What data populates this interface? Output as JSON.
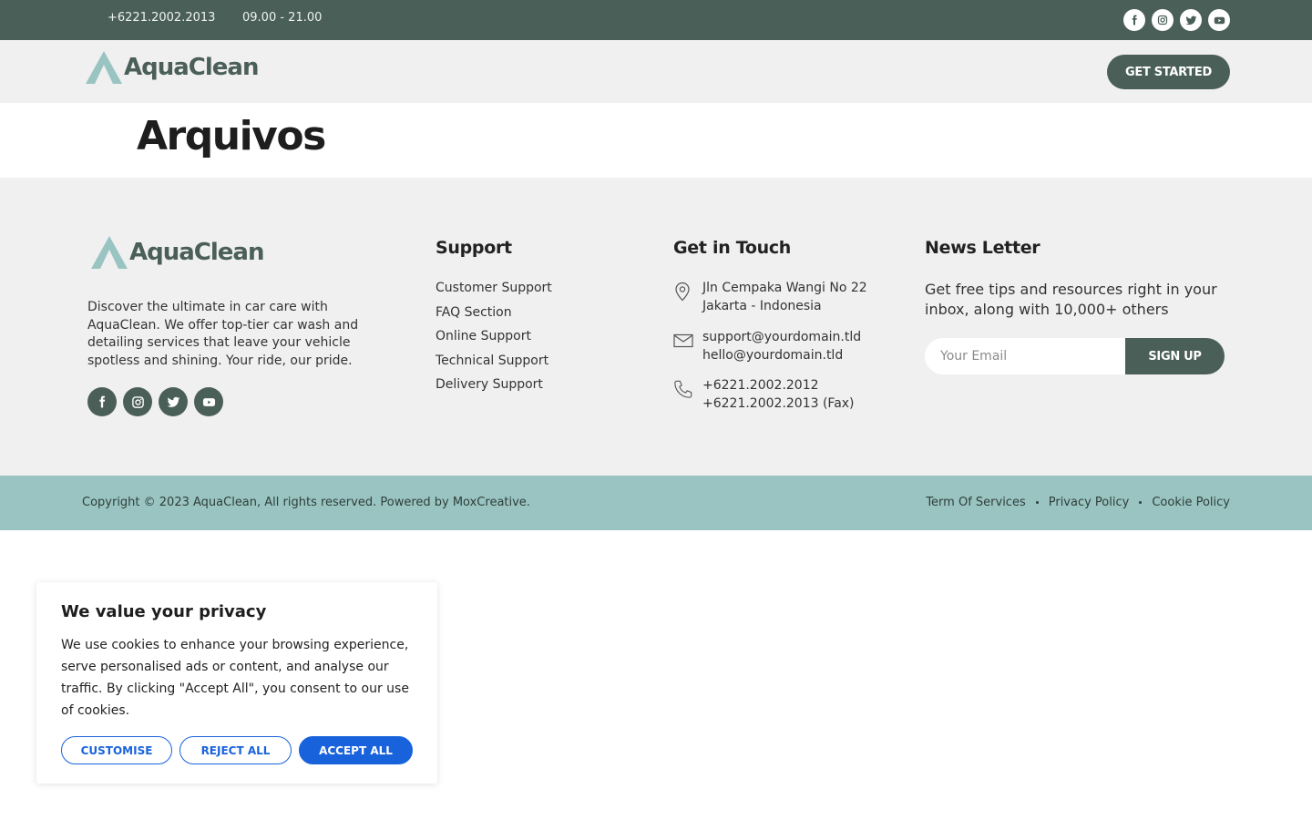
{
  "topbar": {
    "phone": "+6221.2002.2013",
    "hours": "09.00 - 21.00",
    "socials": [
      "facebook-icon",
      "instagram-icon",
      "twitter-icon",
      "youtube-icon"
    ]
  },
  "header": {
    "logo_text": "AquaClean",
    "cta_label": "GET STARTED"
  },
  "page": {
    "title": "Arquivos"
  },
  "footer": {
    "logo_text": "AquaClean",
    "about": "Discover the ultimate in car care with AquaClean. We offer top-tier car wash and detailing services that leave your vehicle spotless and shining. Your ride, our pride.",
    "support": {
      "title": "Support",
      "items": [
        "Customer Support",
        "FAQ Section",
        "Online Support",
        "Technical Support",
        "Delivery Support"
      ]
    },
    "touch": {
      "title": "Get in Touch",
      "address": [
        "Jln Cempaka Wangi No 22",
        "Jakarta - Indonesia"
      ],
      "emails": [
        "support@yourdomain.tld",
        "hello@yourdomain.tld"
      ],
      "phones": [
        "+6221.2002.2012",
        "+6221.2002.2013 (Fax)"
      ]
    },
    "newsletter": {
      "title": "News Letter",
      "description": "Get free tips and resources right in your inbox, along with 10,000+ others",
      "placeholder": "Your Email",
      "button_label": "SIGN UP"
    }
  },
  "copyright": {
    "text": "Copyright © 2023 AquaClean, All rights reserved. Powered by MoxCreative.",
    "links": [
      "Term Of Services",
      "Privacy Policy",
      "Cookie Policy"
    ]
  },
  "cookie": {
    "title": "We value your privacy",
    "text": "We use cookies to enhance your browsing experience, serve personalised ads or content, and analyse our traffic. By clicking \"Accept All\", you consent to our use of cookies.",
    "customise_label": "CUSTOMISE",
    "reject_label": "REJECT ALL",
    "accept_label": "ACCEPT ALL"
  },
  "colors": {
    "primary": "#4b5f59",
    "accent": "#99c4c1",
    "cookie_blue": "#1863dc"
  }
}
